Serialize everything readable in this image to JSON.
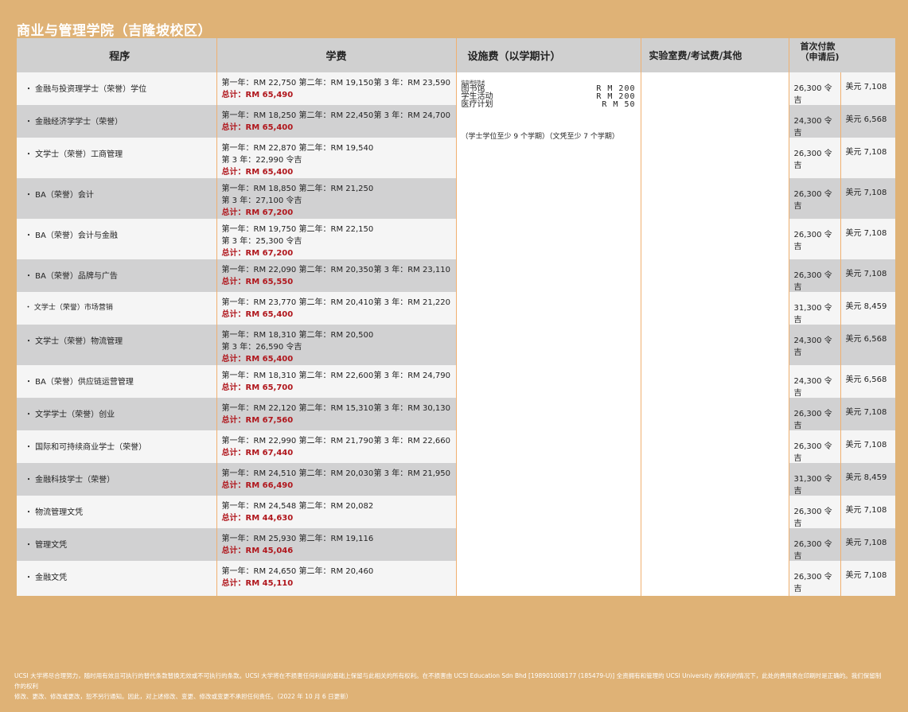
{
  "title": "商业与管理学院（吉隆坡校区）",
  "headers": {
    "program": "程序",
    "tuition": "学费",
    "facility": "设施费（以学期计）",
    "lab": "实验室费/考试费/其他",
    "first_payment_line1": "首次付款",
    "first_payment_line2": "（申请后)"
  },
  "programs": [
    {
      "name": "・ 金融与投资理学士（荣誉）学位",
      "y1": "第一年：RM 22,750",
      "y2": "第二年：RM 19,150",
      "y3": "第 3 年：RM 23,590",
      "total": "总计：RM 65,490",
      "deposit": "26,300 令吉",
      "usd": "美元 7,108"
    },
    {
      "name": "・ 金融经济学学士（荣誉）",
      "y1": "第一年：RM 18,250",
      "y2": "第二年：RM 22,450",
      "y3": "第 3 年：RM 24,700",
      "total": "总计：RM 65,400",
      "deposit": "24,300 令吉",
      "usd": "美元 6,568"
    },
    {
      "name": "・ 文学士（荣誉）工商管理",
      "y1": "第一年：RM 22,870",
      "y2": "第二年：RM 19,540",
      "y3": "第 3 年：22,990 令吉",
      "total": "总计：RM 65,400",
      "deposit": "26,300 令吉",
      "usd": "美元 7,108"
    },
    {
      "name": "・ BA（荣誉）会计",
      "y1": "第一年：RM 18,850",
      "y2": "第二年：RM 21,250",
      "y3": "第 3 年：27,100 令吉",
      "total": "总计：RM 67,200",
      "deposit": "26,300 令吉",
      "usd": "美元 7,108"
    },
    {
      "name": "・ BA（荣誉）会计与金融",
      "y1": "第一年：RM 19,750",
      "y2": "第二年：RM 22,150",
      "y3": "第 3 年：25,300 令吉",
      "total": "总计：RM 67,200",
      "deposit": "26,300 令吉",
      "usd": "美元 7,108"
    },
    {
      "name": "・ BA（荣誉）品牌与广告",
      "y1": "第一年：RM 22,090",
      "y2": "第二年：RM 20,350",
      "y3": "第 3 年：RM 23,110",
      "total": "总计：RM 65,550",
      "deposit": "26,300 令吉",
      "usd": "美元 7,108"
    },
    {
      "name": "・ 文学士（荣誉）市场营销",
      "y1": "第一年：RM 23,770",
      "y2": "第二年：RM 20,410",
      "y3": "第 3 年：RM 21,220",
      "total": "总计：RM 65,400",
      "deposit": "31,300 令吉",
      "usd": "美元 8,459"
    },
    {
      "name": "・ 文学士（荣誉）物流管理",
      "y1": "第一年：RM 18,310",
      "y2": "第二年：RM 20,500",
      "y3": "第 3 年：26,590 令吉",
      "total": "总计：RM 65,400",
      "deposit": "24,300 令吉",
      "usd": "美元 6,568"
    },
    {
      "name": "・ BA（荣誉）供应链运营管理",
      "y1": "第一年：RM 18,310",
      "y2": "第二年：RM 22,600",
      "y3": "第 3 年：RM 24,790",
      "total": "总计：RM 65,700",
      "deposit": "24,300 令吉",
      "usd": "美元 6,568"
    },
    {
      "name": "・ 文学学士（荣誉）创业",
      "y1": "第一年：RM 22,120",
      "y2": "第二年：RM 15,310",
      "y3": "第 3 年：RM 30,130",
      "total": "总计：RM 67,560",
      "deposit": "26,300 令吉",
      "usd": "美元 7,108"
    },
    {
      "name": "・ 国际和可持续商业学士（荣誉）",
      "y1": "第一年：RM 22,990",
      "y2": "第二年：RM 21,790",
      "y3": "第 3 年：RM 22,660",
      "total": "总计：RM 67,440",
      "deposit": "26,300 令吉",
      "usd": "美元 7,108"
    },
    {
      "name": "・ 金融科技学士（荣誉）",
      "y1": "第一年：RM 24,510",
      "y2": "第二年：RM 20,030",
      "y3": "第 3 年：RM 21,950",
      "total": "总计：RM 66,490",
      "deposit": "31,300 令吉",
      "usd": "美元 8,459"
    },
    {
      "name": "・ 物流管理文凭",
      "y1": "第一年：RM 24,548",
      "y2": "第二年：RM 20,082",
      "y3": "",
      "total": "总计：RM 44,630",
      "deposit": "26,300 令吉",
      "usd": "美元 7,108"
    },
    {
      "name": "・ 管理文凭",
      "y1": "第一年：RM 25,930",
      "y2": "第二年：RM 19,116",
      "y3": "",
      "total": "总计：RM 45,046",
      "deposit": "26,300 令吉",
      "usd": "美元 7,108"
    },
    {
      "name": "・ 金融文凭",
      "y1": "第一年：RM 24,650",
      "y2": "第二年：RM 20,460",
      "y3": "",
      "total": "总计：RM 45,110",
      "deposit": "26,300 令吉",
      "usd": "美元 7,108"
    }
  ],
  "facility": {
    "tiny_label": "信息通信技术",
    "items": [
      {
        "label": "图书馆",
        "amount": "R M 200"
      },
      {
        "label": "学生活动",
        "amount": "R M 200"
      },
      {
        "label": "医疗计划",
        "amount": "R M 50"
      }
    ],
    "note": "（学士学位至少 9 个学期）（文凭至少 7 个学期）"
  },
  "footer": {
    "line1": "UCSI 大学将尽合理努力，随时用有效且可执行的替代条款替换无效或不可执行的条款。UCSI 大学将在不损害任何利益的基础上保留与此相关的所有权利。在不损害由 UCSI Education Sdn Bhd [198901008177 (185479-U)] 全资拥有和管理的 UCSI University 的权利的情况下，此处的费用表在印刷时是正确的。我们保留制作的权利",
    "line2": "修改、更改、修改或更改，恕不另行通知。因此，对上述修改、变更、修改或变更不承担任何责任。（2022 年 10 月 6 日更新）"
  }
}
